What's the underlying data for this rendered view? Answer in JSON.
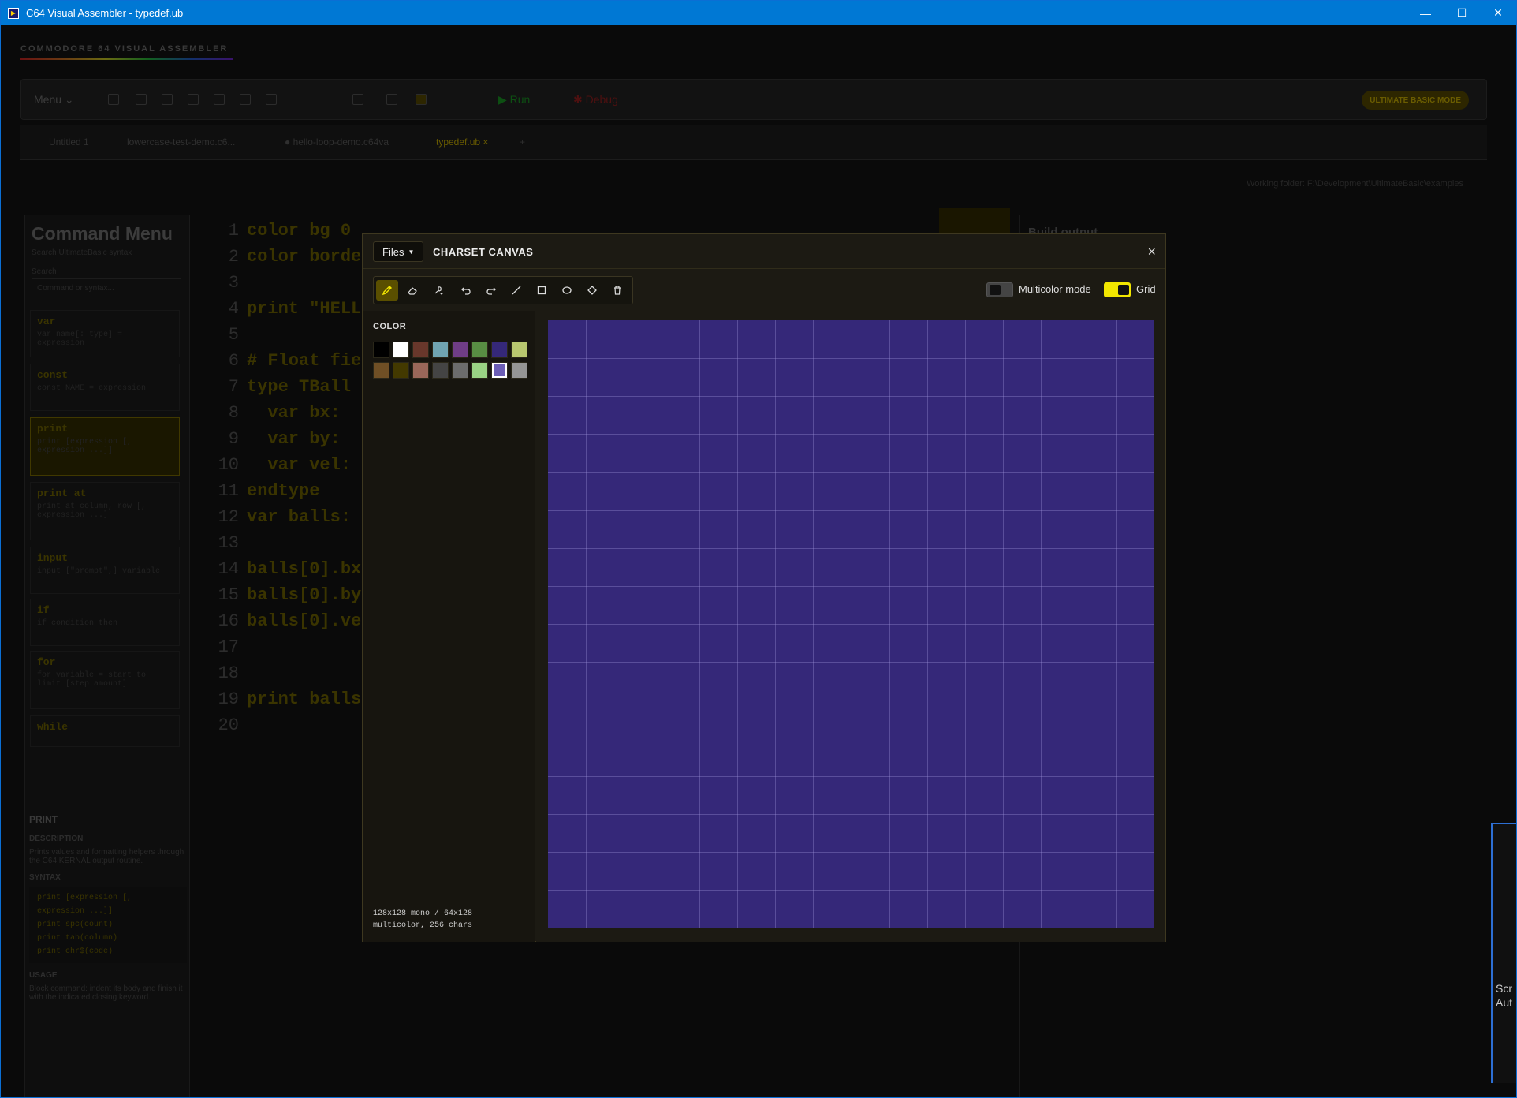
{
  "window": {
    "title": "C64 Visual Assembler - typedef.ub",
    "controls": {
      "minimize": "—",
      "maximize": "☐",
      "close": "✕"
    }
  },
  "app": {
    "logo": "COMMODORE 64 VISUAL ASSEMBLER",
    "toolbar": {
      "menu_label": "Menu",
      "run_label": "Run",
      "debug_label": "Debug",
      "mode_badge": "ULTIMATE BASIC MODE"
    },
    "tabs": [
      {
        "label": "Untitled 1",
        "active": false
      },
      {
        "label": "lowercase-test-demo.c6...",
        "active": false
      },
      {
        "label": "● hello-loop-demo.c64va",
        "active": false
      },
      {
        "label": "typedef.ub  ×",
        "active": true
      },
      {
        "label": "+",
        "active": false
      }
    ],
    "working_folder": "Working folder: F:\\Development\\UltimateBasic\\examples",
    "command_menu": {
      "title": "Command Menu",
      "subtitle": "Search UltimateBasic syntax",
      "search_label": "Search",
      "search_placeholder": "Command or syntax...",
      "items": [
        {
          "name": "var",
          "desc": "var name[: type] = expression"
        },
        {
          "name": "const",
          "desc": "const NAME = expression"
        },
        {
          "name": "print",
          "desc": "print [expression [, expression ...]]",
          "selected": true
        },
        {
          "name": "print at",
          "desc": "print at column, row [, expression ...]"
        },
        {
          "name": "input",
          "desc": "input [\"prompt\",] variable"
        },
        {
          "name": "if",
          "desc": "if condition then"
        },
        {
          "name": "for",
          "desc": "for variable = start to limit [step amount]"
        },
        {
          "name": "while",
          "desc": ""
        }
      ]
    },
    "help": {
      "title": "PRINT",
      "description_label": "DESCRIPTION",
      "description": "Prints values and formatting helpers through the C64 KERNAL output routine.",
      "syntax_label": "SYNTAX",
      "syntax_lines": [
        "print [expression [,",
        "expression ...]]",
        "print spc(count)",
        "print tab(column)",
        "print chr$(code)"
      ],
      "usage_label": "USAGE",
      "usage": "Block command: indent its body and finish it with the indicated closing keyword."
    },
    "editor": {
      "line_numbers": [
        "1",
        "2",
        "3",
        "4",
        "5",
        "6",
        "7",
        "8",
        "9",
        "10",
        "11",
        "12",
        "13",
        "14",
        "15",
        "16",
        "17",
        "18",
        "19",
        "20"
      ],
      "lines": [
        "color bg 0",
        "color borde",
        "",
        "print \"HELL",
        "",
        "# Float fie",
        "type TBall",
        "  var bx:",
        "  var by:",
        "  var vel:",
        "endtype",
        "var balls: ",
        "",
        "balls[0].bx",
        "balls[0].by",
        "balls[0].ve",
        "",
        "",
        "print balls",
        ""
      ]
    },
    "build_output_title": "Build output"
  },
  "modal": {
    "files_label": "Files",
    "title": "CHARSET CANVAS",
    "close_label": "×",
    "tools": [
      {
        "icon": "pencil-icon",
        "active": true
      },
      {
        "icon": "eraser-icon",
        "active": false
      },
      {
        "icon": "brush-dropdown-icon",
        "active": false
      },
      {
        "icon": "undo-icon",
        "active": false
      },
      {
        "icon": "redo-icon",
        "active": false
      },
      {
        "icon": "line-icon",
        "active": false
      },
      {
        "icon": "rectangle-icon",
        "active": false
      },
      {
        "icon": "ellipse-icon",
        "active": false
      },
      {
        "icon": "fill-icon",
        "active": false
      },
      {
        "icon": "trash-icon",
        "active": false
      }
    ],
    "multicolor_label": "Multicolor mode",
    "multicolor_on": false,
    "grid_label": "Grid",
    "grid_on": true,
    "color_label": "COLOR",
    "palette": [
      "#000000",
      "#ffffff",
      "#68372b",
      "#70a4b2",
      "#6f3d86",
      "#588d43",
      "#352879",
      "#b8c76f",
      "#6f4f25",
      "#433900",
      "#9a6759",
      "#444444",
      "#6c6c6c",
      "#9ad284",
      "#6c5eb5",
      "#959595"
    ],
    "selected_color_index": 14,
    "canvas_color": "#352879",
    "grid_divisions": 16,
    "info_line1": "128x128 mono / 64x128",
    "info_line2": "multicolor, 256 chars"
  },
  "taskbar_thumb": {
    "line1": "Scr",
    "line2": "Aut"
  }
}
